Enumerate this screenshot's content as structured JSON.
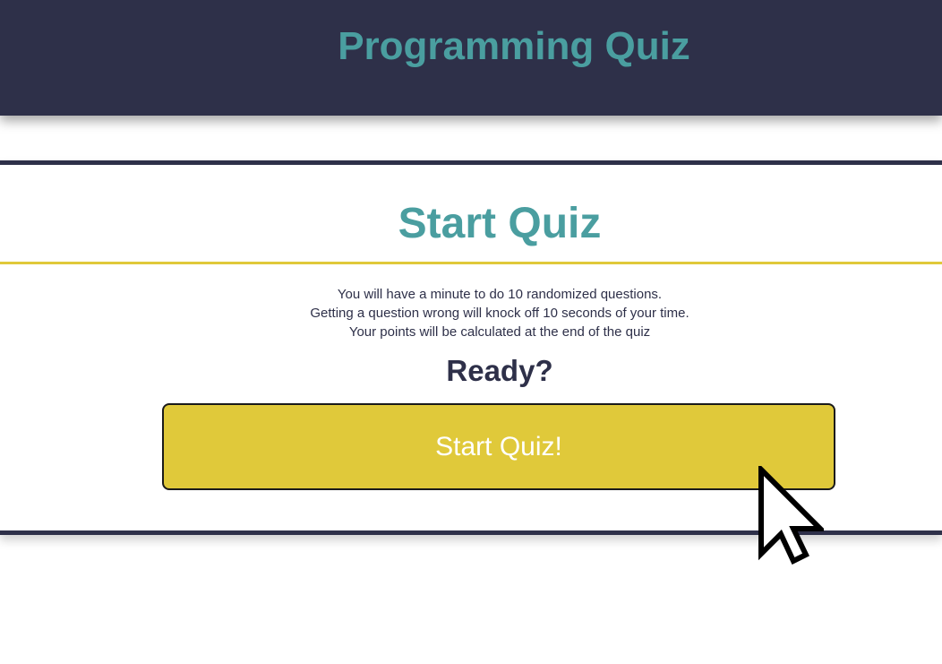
{
  "header": {
    "title": "Programming Quiz"
  },
  "start_card": {
    "title": "Start Quiz",
    "instructions": [
      "You will have a minute to do 10 randomized questions.",
      "Getting a question wrong will knock off 10 seconds of your time.",
      "Your points will be calculated at the end of the quiz"
    ],
    "ready_text": "Ready?",
    "start_button_label": "Start Quiz!"
  },
  "colors": {
    "header_bg": "#2e3049",
    "accent_teal": "#4a9ea0",
    "accent_yellow": "#e0c93a",
    "text_dark": "#2e3049"
  },
  "icons": {
    "cursor": "mouse-pointer-icon"
  }
}
